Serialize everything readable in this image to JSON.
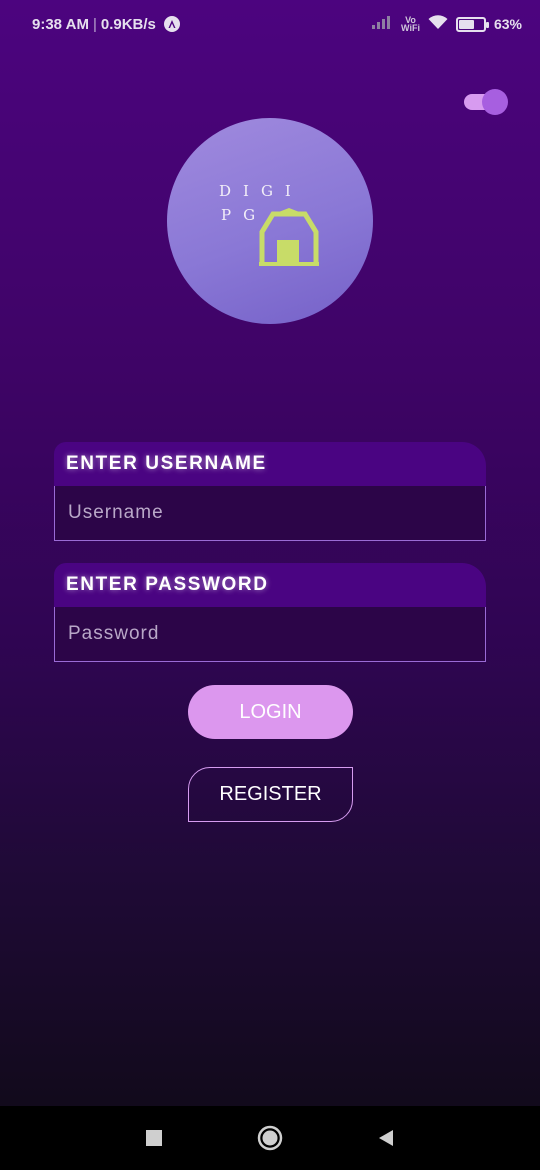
{
  "status_bar": {
    "time": "9:38 AM",
    "separator": "|",
    "network_speed": "0.9KB/s",
    "notification_icon": "a-circle-icon",
    "signal_icon": "signal-icon",
    "vowifi_top": "Vo",
    "vowifi_bottom": "WiFi",
    "wifi_icon": "wifi-icon",
    "battery_level": 0.63,
    "battery_percent": "63%"
  },
  "theme_toggle": {
    "state": "on",
    "track_color": "#d79bf0",
    "thumb_color": "#a75fe0"
  },
  "logo": {
    "line1": "DIGI",
    "line2": "PG",
    "icon": "house-icon",
    "circle_color": "#8a78d6",
    "icon_color": "#c8dc68"
  },
  "form": {
    "username": {
      "header": "ENTER USERNAME",
      "placeholder": "Username",
      "value": ""
    },
    "password": {
      "header": "ENTER PASSWORD",
      "placeholder": "Password",
      "value": ""
    },
    "login_label": "LOGIN",
    "register_label": "REGISTER"
  },
  "nav_bar": {
    "recents_icon": "square-icon",
    "home_icon": "circle-home-icon",
    "back_icon": "back-triangle-icon"
  },
  "colors": {
    "accent": "#dc97ee",
    "header_bg": "#4a0482",
    "input_bg": "#2c0548",
    "input_border": "#9a6bd6"
  }
}
